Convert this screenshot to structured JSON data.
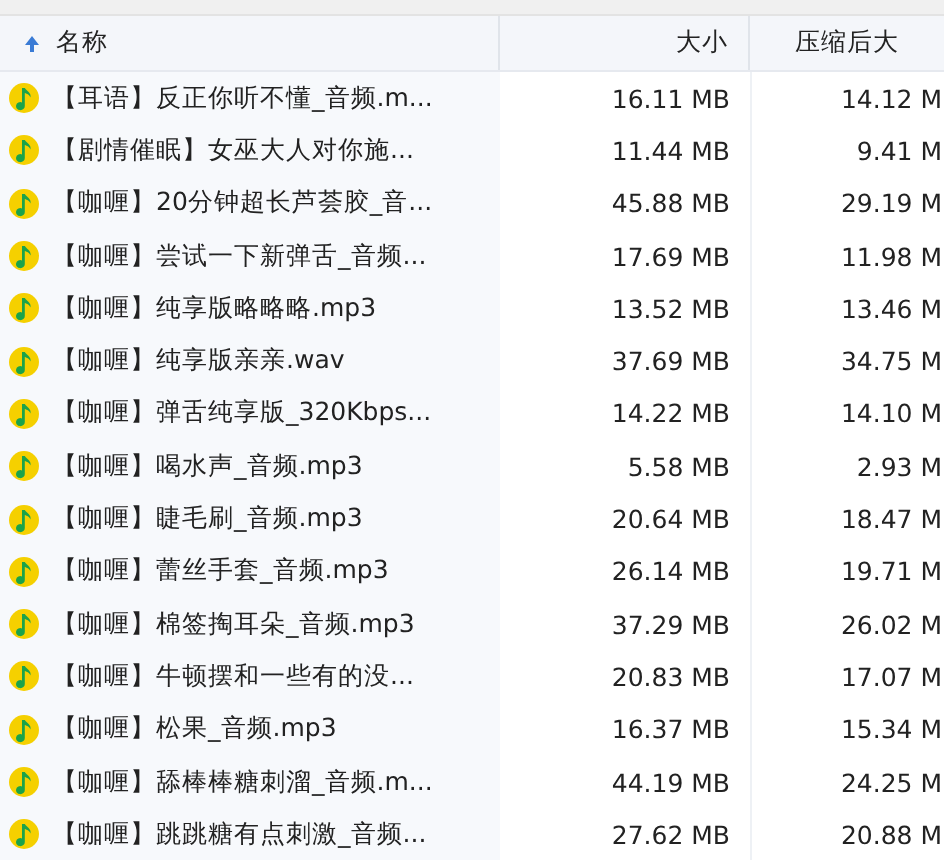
{
  "table": {
    "columns": [
      {
        "label": "名称",
        "sorted": true
      },
      {
        "label": "大小",
        "sorted": false
      },
      {
        "label": "压缩后大",
        "sorted": false
      }
    ],
    "rows": [
      {
        "name": "【耳语】反正你听不懂_音频.m...",
        "size": "16.11 MB",
        "compressed": "14.12 M"
      },
      {
        "name": "【剧情催眠】女巫大人对你施...",
        "size": "11.44 MB",
        "compressed": "9.41 M"
      },
      {
        "name": "【咖喱】20分钟超长芦荟胶_音...",
        "size": "45.88 MB",
        "compressed": "29.19 M"
      },
      {
        "name": "【咖喱】尝试一下新弹舌_音频...",
        "size": "17.69 MB",
        "compressed": "11.98 M"
      },
      {
        "name": "【咖喱】纯享版略略略.mp3",
        "size": "13.52 MB",
        "compressed": "13.46 M"
      },
      {
        "name": "【咖喱】纯享版亲亲.wav",
        "size": "37.69 MB",
        "compressed": "34.75 M"
      },
      {
        "name": "【咖喱】弹舌纯享版_320Kbps...",
        "size": "14.22 MB",
        "compressed": "14.10 M"
      },
      {
        "name": "【咖喱】喝水声_音频.mp3",
        "size": "5.58 MB",
        "compressed": "2.93 M"
      },
      {
        "name": "【咖喱】睫毛刷_音频.mp3",
        "size": "20.64 MB",
        "compressed": "18.47 M"
      },
      {
        "name": "【咖喱】蕾丝手套_音频.mp3",
        "size": "26.14 MB",
        "compressed": "19.71 M"
      },
      {
        "name": "【咖喱】棉签掏耳朵_音频.mp3",
        "size": "37.29 MB",
        "compressed": "26.02 M"
      },
      {
        "name": "【咖喱】牛顿摆和一些有的没...",
        "size": "20.83 MB",
        "compressed": "17.07 M"
      },
      {
        "name": "【咖喱】松果_音频.mp3",
        "size": "16.37 MB",
        "compressed": "15.34 M"
      },
      {
        "name": "【咖喱】舔棒棒糖刺溜_音频.m...",
        "size": "44.19 MB",
        "compressed": "24.25 M"
      },
      {
        "name": "【咖喱】跳跳糖有点刺激_音频...",
        "size": "27.62 MB",
        "compressed": "20.88 M"
      }
    ]
  }
}
